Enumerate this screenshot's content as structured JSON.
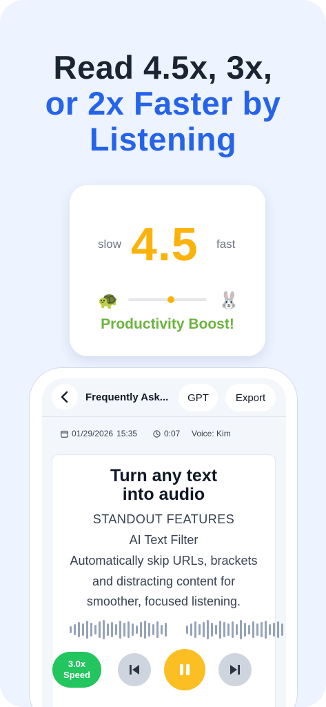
{
  "headline": {
    "line1": "Read 4.5x, 3x,",
    "line2": "or 2x Faster by",
    "line3": "Listening"
  },
  "speed_card": {
    "slow_label": "slow",
    "value": "4.5",
    "fast_label": "fast",
    "left_emoji": "🐢",
    "right_emoji": "🐰",
    "slider_fraction": 0.5,
    "boost_text": "Productivity Boost!"
  },
  "app": {
    "title": "Frequently Ask...",
    "gpt_label": "GPT",
    "export_label": "Export",
    "meta": {
      "date": "01/29/2026",
      "time": "15:35",
      "duration": "0:07",
      "voice": "Voice: Kim"
    },
    "doc": {
      "title_line1": "Turn any text",
      "title_line2": "into audio",
      "lines": [
        "STANDOUT FEATURES",
        "AI Text Filter",
        "Automatically skip URLs, brackets",
        "and distracting content for",
        "smoother, focused listening."
      ]
    },
    "player": {
      "speed_value": "3.0x",
      "speed_label": "Speed"
    }
  },
  "colors": {
    "background": "#edf3ff",
    "headline_dark": "#1a2433",
    "headline_accent": "#2563eb",
    "speed_value": "#fbb20a",
    "boost": "#6cb33f",
    "speed_button": "#22c55e",
    "play_button": "#fbbf24"
  },
  "icons": [
    "back-chevron-icon",
    "calendar-icon",
    "clock-icon",
    "skip-previous-icon",
    "pause-icon",
    "skip-next-icon"
  ]
}
